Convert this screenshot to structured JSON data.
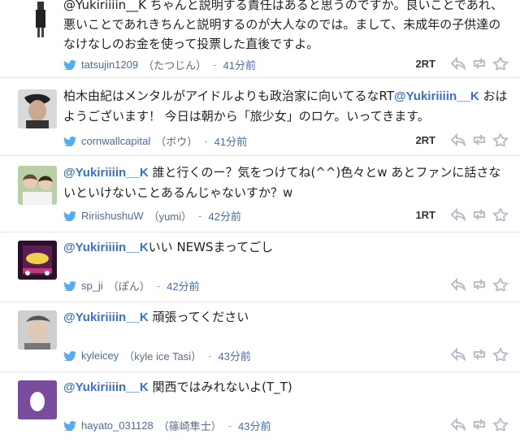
{
  "tweets": [
    {
      "mention": "",
      "text": "@Yukiriiiin__K ちゃんと説明する責任はあると思うのですか。良いことであれ、悪いことであれきちんと説明するのが大人なのでは。まして、未成年の子供達のなけなしのお金を使って投票した直後ですよ。",
      "handle": "tatsujin1209",
      "name": "（たつじん）",
      "time": "41分前",
      "rt": "2RT"
    },
    {
      "text": "柏木由紀はメンタルがアイドルよりも政治家に向いてるなRT",
      "mention": "@Yukiriiiin__K",
      "text2": " おはようございます！ 今日は朝から「旅少女」のロケ。いってきます。",
      "handle": "cornwallcapital",
      "name": "（ボウ）",
      "time": "41分前",
      "rt": "2RT"
    },
    {
      "mention": "@Yukiriiiin__K",
      "text": " 誰と行くのー？気をつけてね(^^)色々とw あとファンに話さないといけないことあるんじゃないすか？w",
      "handle": "RiriishushuW",
      "name": "（yumi）",
      "time": "42分前",
      "rt": "1RT"
    },
    {
      "mention": "@Yukiriiiin__K",
      "text": "いい NEWSまってごし",
      "handle": "sp_ji",
      "name": "（ぽん）",
      "time": "42分前",
      "rt": ""
    },
    {
      "mention": "@Yukiriiiin__K",
      "text": " 頑張ってください",
      "handle": "kyleicey",
      "name": "（kyle ice Tasi）",
      "time": "43分前",
      "rt": ""
    },
    {
      "mention": "@Yukiriiiin__K",
      "text": " 関西ではみれないよ(T_T)",
      "handle": "hayato_031128",
      "name": "（篠崎隼士）",
      "time": "43分前",
      "rt": ""
    }
  ],
  "colors": {
    "link": "#3b6fd0",
    "meta": "#6f7f99",
    "bird": "#55acee",
    "action": "#b7bfca"
  }
}
